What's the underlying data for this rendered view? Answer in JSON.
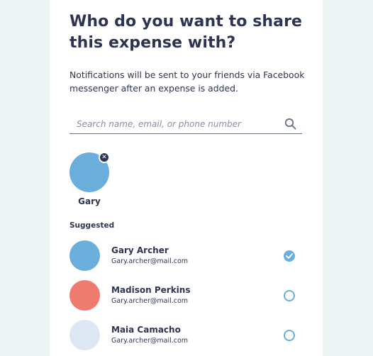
{
  "heading": "Who do you want to share this expense with?",
  "subtitle": "Notifications will be sent to your friends via Facebook messenger after an expense is added.",
  "search": {
    "placeholder": "Search name, email, or phone number",
    "icon": "search-icon"
  },
  "selected": [
    {
      "name": "Gary",
      "color": "#6aaedb",
      "remove_icon": "close-icon",
      "remove_glyph": "✕"
    }
  ],
  "suggested_label": "Suggested",
  "contacts": [
    {
      "name": "Gary Archer",
      "email": "Gary.archer@mail.com",
      "color": "#6aaedb",
      "selected": true
    },
    {
      "name": "Madison Perkins",
      "email": "Gary.archer@mail.com",
      "color": "#ef7a6e",
      "selected": false
    },
    {
      "name": "Maia Camacho",
      "email": "Gary.archer@mail.com",
      "color": "#dde7f3",
      "selected": false
    }
  ],
  "colors": {
    "accent": "#6aaedb",
    "text": "#2d3452",
    "page_background": "#eef3f3"
  }
}
